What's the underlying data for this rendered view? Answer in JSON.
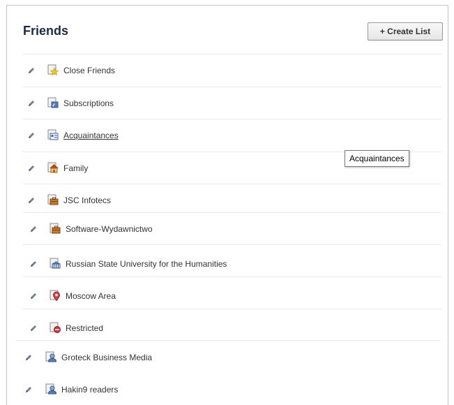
{
  "header": {
    "title": "Friends",
    "create_list_label": "+ Create List"
  },
  "lists": [
    {
      "label": "Close Friends",
      "icon": "star-list-icon"
    },
    {
      "label": "Subscriptions",
      "icon": "subscriptions-icon"
    },
    {
      "label": "Acquaintances",
      "icon": "acquaintances-icon"
    },
    {
      "label": "Family",
      "icon": "family-house-icon"
    },
    {
      "label": "JSC Infotecs",
      "icon": "work-briefcase-icon"
    },
    {
      "label": "Software-Wydawnictwo",
      "icon": "work-briefcase-icon"
    },
    {
      "label": "Russian State University for the Humanities",
      "icon": "school-icon"
    },
    {
      "label": "Moscow Area",
      "icon": "location-pin-icon"
    },
    {
      "label": "Restricted",
      "icon": "restricted-icon"
    },
    {
      "label": "Groteck Business Media",
      "icon": "person-list-icon"
    },
    {
      "label": "Hakin9 readers",
      "icon": "person-list-icon"
    }
  ],
  "tooltip": {
    "text": "Acquaintances"
  },
  "colors": {
    "title": "#1c2a47",
    "divider": "#e9e9e9",
    "border": "#c4c4c4"
  }
}
